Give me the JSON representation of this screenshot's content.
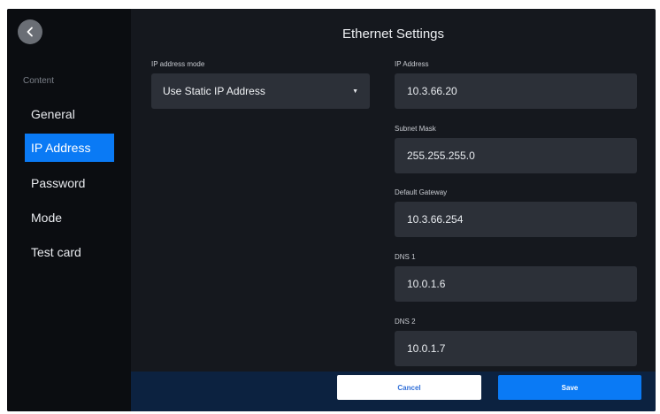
{
  "header": {
    "title": "Ethernet Settings"
  },
  "sidebar": {
    "section_label": "Content",
    "items": [
      {
        "label": "General",
        "active": false
      },
      {
        "label": "IP Address",
        "active": true
      },
      {
        "label": "Password",
        "active": false
      },
      {
        "label": "Mode",
        "active": false
      },
      {
        "label": "Test card",
        "active": false
      }
    ],
    "back_icon": "chevron-left-icon"
  },
  "form": {
    "ip_mode": {
      "label": "IP address mode",
      "value": "Use Static IP Address"
    },
    "ip_address": {
      "label": "IP Address",
      "value": "10.3.66.20"
    },
    "subnet_mask": {
      "label": "Subnet Mask",
      "value": "255.255.255.0"
    },
    "default_gateway": {
      "label": "Default Gateway",
      "value": "10.3.66.254"
    },
    "dns1": {
      "label": "DNS 1",
      "value": "10.0.1.6"
    },
    "dns2": {
      "label": "DNS 2",
      "value": "10.0.1.7"
    }
  },
  "footer": {
    "cancel_label": "Cancel",
    "save_label": "Save"
  },
  "colors": {
    "accent": "#0a7af5",
    "background": "#15181e",
    "sidebar": "#0b0d11",
    "field": "#2c3038",
    "footer": "#0c2240"
  }
}
